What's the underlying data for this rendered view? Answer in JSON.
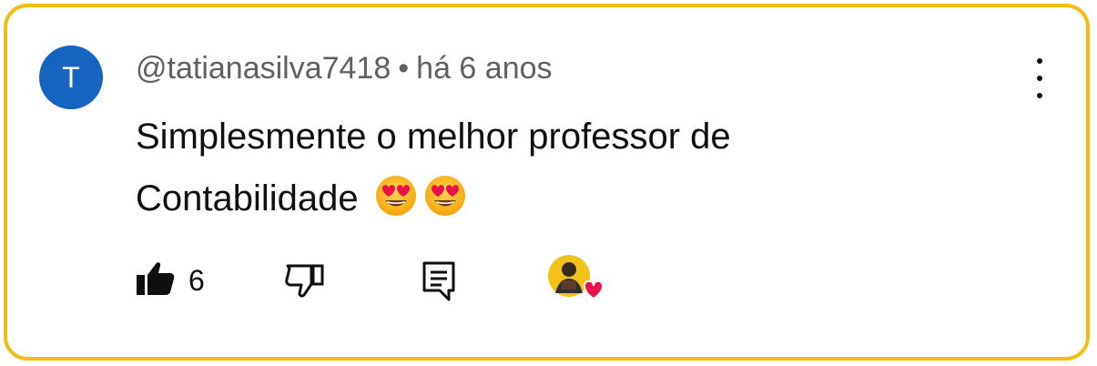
{
  "comment": {
    "avatar_letter": "T",
    "avatar_color": "#1565c0",
    "author": "@tatianasilva7418",
    "separator": "•",
    "time_ago": "há 6 anos",
    "text": "Simplesmente o melhor professor de Contabilidade",
    "emojis": [
      "heart-eyes-emoji",
      "heart-eyes-emoji"
    ]
  },
  "actions": {
    "like_count": "6",
    "like_icon": "thumbs-up-icon",
    "dislike_icon": "thumbs-down-icon",
    "reply_icon": "reply-comment-icon",
    "creator_heart": "creator-heart-badge"
  },
  "colors": {
    "border": "#f2bd13",
    "heart": "#e8114a",
    "text": "#0f0f0f",
    "meta": "#606060"
  }
}
